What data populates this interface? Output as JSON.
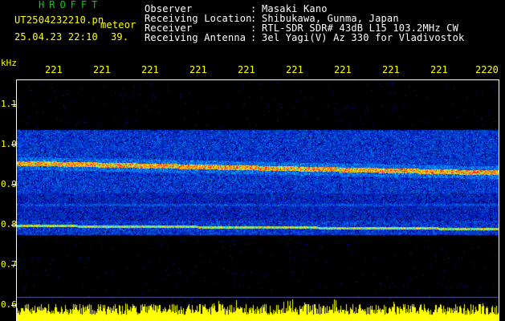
{
  "header": {
    "brand": "HROFFT",
    "filename": "UT2504232210.pn",
    "meteor_label": "meteor",
    "datetime": "25.04.23 22:10",
    "count": "39."
  },
  "station_info": [
    {
      "label": "Observer",
      "sep": ":",
      "value": "Masaki Kano"
    },
    {
      "label": "Receiving Location",
      "sep": ":",
      "value": "Shibukawa, Gunma, Japan"
    },
    {
      "label": "Receiver",
      "sep": ":",
      "value": "RTL-SDR SDR# 43dB L15 103.2MHz CW"
    },
    {
      "label": "Receiving Antenna",
      "sep": ":",
      "value": "3el Yagi(V) Az 330 for Vladivostok"
    }
  ],
  "axes": {
    "y_unit": "kHz",
    "y_ticks": [
      "1.1",
      "1.0",
      "0.9",
      "0.8",
      "0.7",
      "0.6"
    ],
    "x_ticks": [
      "221",
      "221",
      "221",
      "221",
      "221",
      "221",
      "221",
      "221",
      "221",
      "2220"
    ]
  },
  "colors": {
    "background": "#000000",
    "text_info": "#ffffff",
    "text_accent": "#ffff00",
    "brand": "#00d000",
    "waterfall_low": "#00007a",
    "waterfall_mid": "#00c8ff",
    "waterfall_high": "#ffff00",
    "waterfall_peak": "#ff2020",
    "level_bar": "#ffff00"
  }
}
